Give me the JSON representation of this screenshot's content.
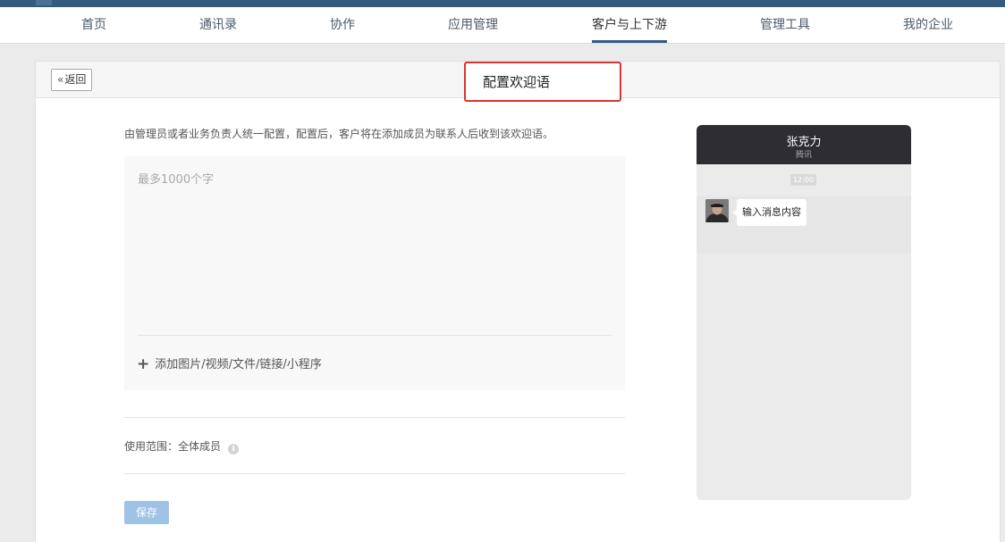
{
  "nav": {
    "items": [
      {
        "label": "首页"
      },
      {
        "label": "通讯录"
      },
      {
        "label": "协作"
      },
      {
        "label": "应用管理"
      },
      {
        "label": "客户与上下游",
        "active": true
      },
      {
        "label": "管理工具"
      },
      {
        "label": "我的企业"
      }
    ]
  },
  "header": {
    "back_label": "返回",
    "back_icon": "double-chevron-left-icon",
    "title": "配置欢迎语"
  },
  "form": {
    "description": "由管理员或者业务负责人统一配置，配置后，客户将在添加成员为联系人后收到该欢迎语。",
    "message_value": "",
    "message_placeholder": "最多1000个字",
    "add_attachment_label": "添加图片/视频/文件/链接/小程序",
    "scope_label": "使用范围：",
    "scope_value": "全体成员",
    "save_label": "保存"
  },
  "preview": {
    "contact_name": "张克力",
    "contact_org": "腾讯",
    "time": "12:00",
    "message_placeholder": "输入消息内容"
  },
  "colors": {
    "topbar": "#355a82",
    "active_tab_underline": "#2f5a8c",
    "highlight_box": "#e0302f",
    "save_button": "#9fc3e5",
    "phone_header": "#2d2d32"
  }
}
